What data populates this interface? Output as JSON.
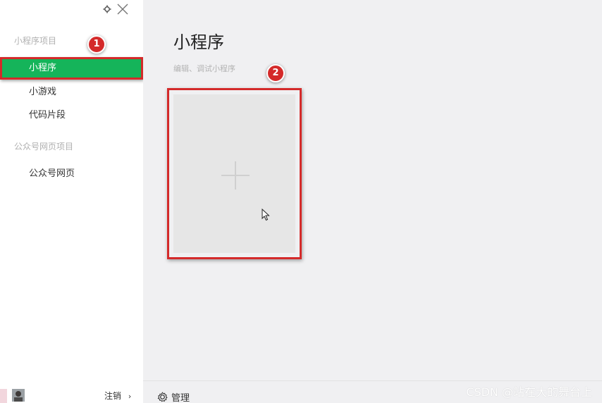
{
  "sidebar": {
    "section_miniprogram": "小程序项目",
    "items": [
      {
        "label": "小程序"
      },
      {
        "label": "小游戏"
      },
      {
        "label": "代码片段"
      }
    ],
    "section_official": "公众号网页项目",
    "official_items": [
      {
        "label": "公众号网页"
      }
    ],
    "logout_label": "注销"
  },
  "annotations": {
    "badge1": "1",
    "badge2": "2"
  },
  "main": {
    "title": "小程序",
    "subtitle": "编辑、调试小程序",
    "manage_label": "管理"
  },
  "watermark": "CSDN @站在大的舞台上",
  "icons": {
    "settings": "gear-icon",
    "close": "close-icon",
    "add": "plus-icon",
    "pointer": "cursor-icon"
  },
  "colors": {
    "active_nav": "#15b45a",
    "highlight_border": "#d42a2a"
  }
}
